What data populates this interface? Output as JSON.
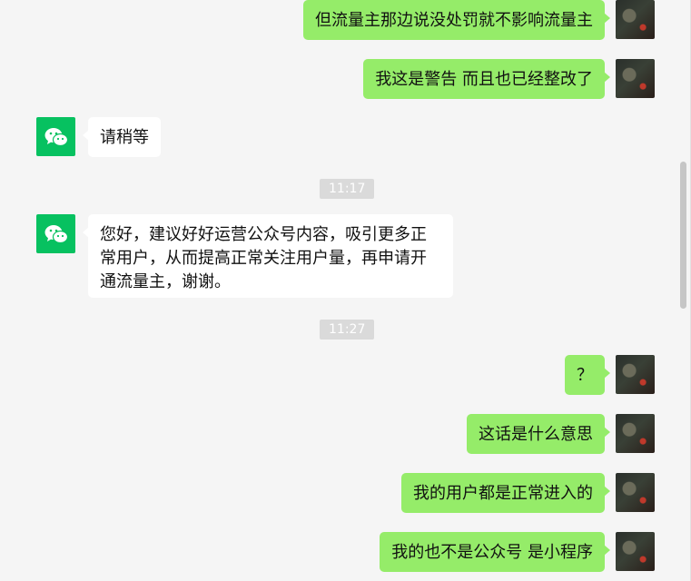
{
  "messages": [
    {
      "text": "但流量主那边说没处罚就不影响流量主"
    },
    {
      "text": "我这是警告 而且也已经整改了"
    },
    {
      "text": "请稍等"
    },
    {
      "text": "11:17"
    },
    {
      "text": "您好，建议好好运营公众号内容，吸引更多正常用户，从而提高正常关注用户量，再申请开通流量主，谢谢。"
    },
    {
      "text": "11:27"
    },
    {
      "text": "？"
    },
    {
      "text": "这话是什么意思"
    },
    {
      "text": "我的用户都是正常进入的"
    },
    {
      "text": "我的也不是公众号 是小程序"
    }
  ],
  "colors": {
    "sent_bubble": "#95ec69",
    "received_bubble": "#ffffff",
    "wechat_green": "#07c160",
    "background": "#f5f5f5"
  }
}
